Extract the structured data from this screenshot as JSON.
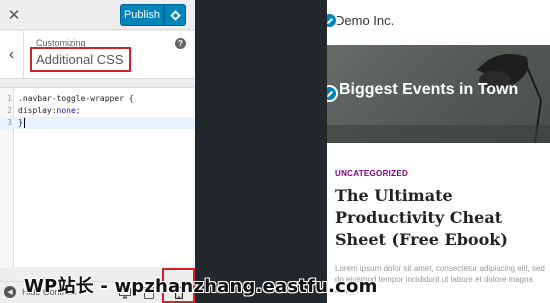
{
  "topbar": {
    "publish_label": "Publish",
    "icons": [
      "close-icon",
      "gear-icon"
    ]
  },
  "section": {
    "customizing_label": "Customizing",
    "title": "Additional CSS"
  },
  "editor": {
    "lines": [
      {
        "num": "1",
        "code": ".navbar-toggle-wrapper {"
      },
      {
        "num": "2",
        "prop": "display:",
        "value": "none;"
      },
      {
        "num": "3",
        "code": "}"
      }
    ]
  },
  "footer": {
    "hide_controls_label": "Hide Controls",
    "devices": [
      "desktop-icon",
      "tablet-icon",
      "mobile-icon"
    ]
  },
  "preview": {
    "site_title": "Demo Inc.",
    "hero_title": "Biggest Events in Town",
    "category": "UNCATEGORIZED",
    "post_title": "The Ultimate Productivity Cheat Sheet (Free Ebook)",
    "excerpt": "Lorem ipsum dolor sit amet, consectetur adipiscing elit, sed do eiusmod tempor incididunt ut labore et dolore magna aliqua."
  },
  "watermark": "WP站长 - wpzhanzhang.eastfu.com",
  "colors": {
    "accent": "#0085ba",
    "highlight": "#d2232a",
    "category": "#800080"
  }
}
